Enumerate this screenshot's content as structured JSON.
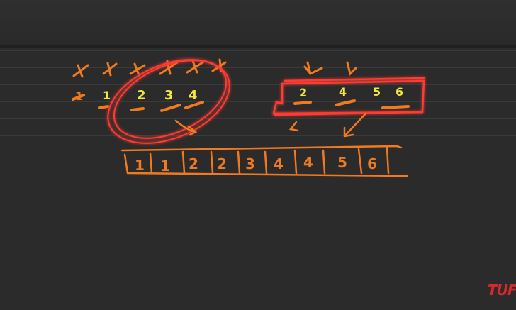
{
  "left_group": {
    "top_marks": [
      "×",
      "×",
      "×",
      "×",
      "×",
      "×"
    ],
    "digits": [
      "1",
      "1",
      "2",
      "3",
      "4"
    ]
  },
  "right_group": {
    "digits": [
      "2",
      "4",
      "5",
      "6"
    ]
  },
  "merged_array": {
    "cells": [
      "1",
      "1",
      "2",
      "2",
      "3",
      "4",
      "4",
      "5",
      "6"
    ]
  },
  "watermark": "TUF",
  "colors": {
    "background": "#2b2b2b",
    "ink_orange": "#f07a20",
    "ink_yellow": "#f2e640",
    "highlight_red": "#ff3030"
  }
}
